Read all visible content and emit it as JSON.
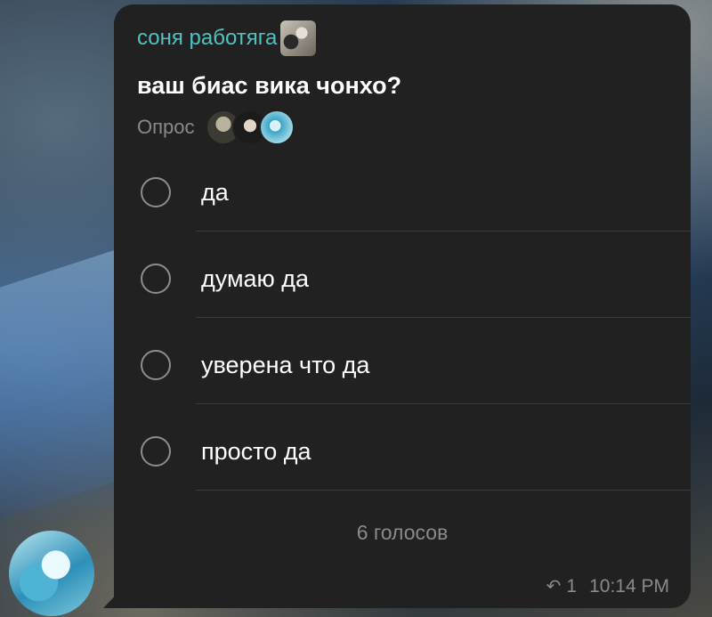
{
  "message": {
    "sender_name": "соня работяга",
    "question": "ваш биас вика чонхо?",
    "poll_type": "Опрос",
    "options": [
      {
        "label": "да"
      },
      {
        "label": "думаю да"
      },
      {
        "label": "уверена что да"
      },
      {
        "label": "просто да"
      }
    ],
    "votes_label": "6 голосов",
    "reply_count": "1",
    "time": "10:14 PM"
  },
  "colors": {
    "bubble": "#212121",
    "sender_accent": "#4fc3c1",
    "muted_text": "#8a8a8a"
  },
  "icons": {
    "reply": "reply-arrow-icon"
  }
}
